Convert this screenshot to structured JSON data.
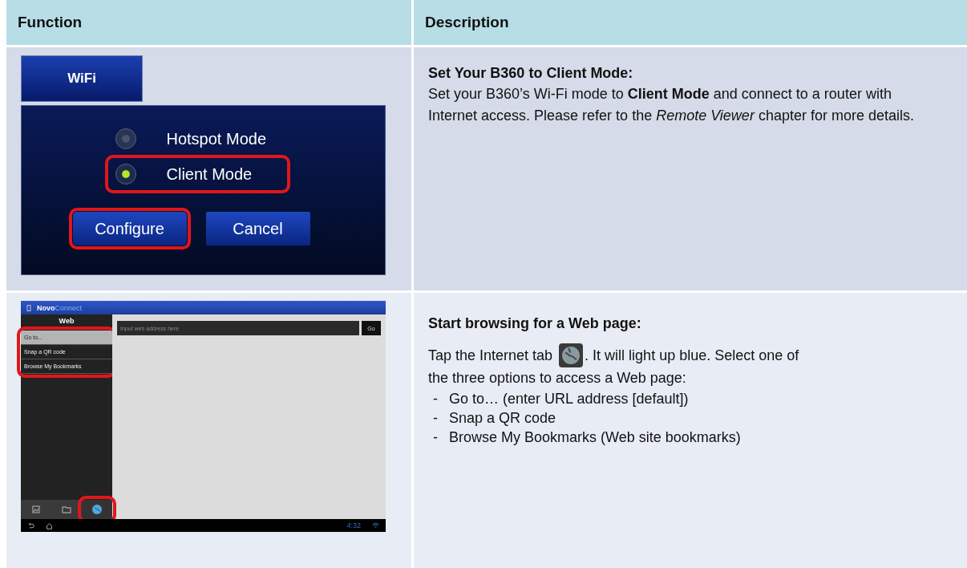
{
  "table": {
    "columns": [
      "Function",
      "Description"
    ],
    "rows": [
      {
        "kind": "wifi",
        "screen": {
          "tab": "WiFi",
          "options": [
            {
              "label": "Hotspot Mode",
              "selected": false,
              "highlighted": false
            },
            {
              "label": "Client Mode",
              "selected": true,
              "highlighted": true
            }
          ],
          "buttons": [
            {
              "label": "Configure",
              "highlighted": true
            },
            {
              "label": "Cancel",
              "highlighted": false
            }
          ]
        },
        "heading": "Set Your B360 to Client Mode:",
        "paragraph": "Set your B360’s Wi-Fi mode to **Client Mode** and connect to a router with Internet access. Please refer to the *Remote Viewer* chapter for more details."
      },
      {
        "kind": "web",
        "screen": {
          "brand": [
            "Novo",
            "Connect"
          ],
          "panel_title": "Web",
          "menu_highlighted": true,
          "menu": [
            {
              "label": "Go to...",
              "selected": true
            },
            {
              "label": "Snap a QR code",
              "selected": false
            },
            {
              "label": "Browse My Bookmarks",
              "selected": false
            }
          ],
          "address_placeholder": "Input web address here",
          "go_button": "Go",
          "tabs": [
            {
              "kind": "photos",
              "selected": false,
              "highlighted": false
            },
            {
              "kind": "folder",
              "selected": false,
              "highlighted": false
            },
            {
              "kind": "internet",
              "selected": true,
              "highlighted": true
            }
          ],
          "clock": "4:32"
        },
        "heading": "Start browsing for a Web page:",
        "intro_before_icon": "Tap the Internet tab",
        "intro_after_icon": ". It will light up blue. Select one of",
        "intro_continued": "the three options to access a Web page:",
        "bullets": [
          {
            "marker": "-",
            "text": "Go to… (enter URL address [default])"
          },
          {
            "marker": "-",
            "text": "Snap a QR code"
          },
          {
            "marker": "-",
            "text": "Browse My Bookmarks (Web site bookmarks)"
          }
        ]
      }
    ]
  }
}
